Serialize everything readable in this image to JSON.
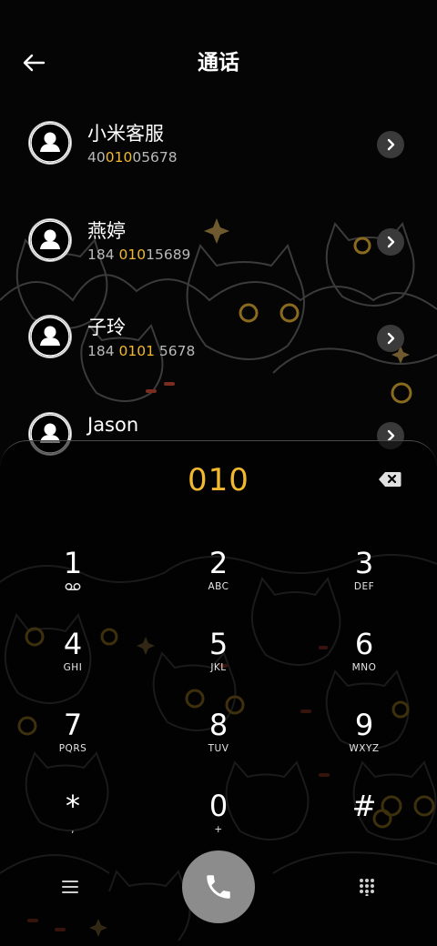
{
  "header": {
    "title": "通话",
    "back_icon": "arrow-left-icon"
  },
  "contacts": [
    {
      "name": "小米客服",
      "number_parts": [
        "40",
        "010",
        "05678"
      ]
    },
    {
      "name": "燕婷",
      "number_parts": [
        "184 ",
        "010",
        "15689"
      ]
    },
    {
      "name": "子玲",
      "number_parts": [
        "184 ",
        "0101",
        " 5678"
      ]
    },
    {
      "name": "Jason",
      "number_parts": [
        "",
        "",
        ""
      ]
    }
  ],
  "dialer": {
    "input_value": "010",
    "keys": [
      {
        "digit": "1",
        "letters": ""
      },
      {
        "digit": "2",
        "letters": "ABC"
      },
      {
        "digit": "3",
        "letters": "DEF"
      },
      {
        "digit": "4",
        "letters": "GHI"
      },
      {
        "digit": "5",
        "letters": "JKL"
      },
      {
        "digit": "6",
        "letters": "MNO"
      },
      {
        "digit": "7",
        "letters": "PQRS"
      },
      {
        "digit": "8",
        "letters": "TUV"
      },
      {
        "digit": "9",
        "letters": "WXYZ"
      },
      {
        "digit": "*",
        "letters": ","
      },
      {
        "digit": "0",
        "letters": "+"
      },
      {
        "digit": "#",
        "letters": ""
      }
    ]
  },
  "colors": {
    "accent": "#f2b830",
    "background": "#050505",
    "call_button": "#8c8c8c"
  }
}
